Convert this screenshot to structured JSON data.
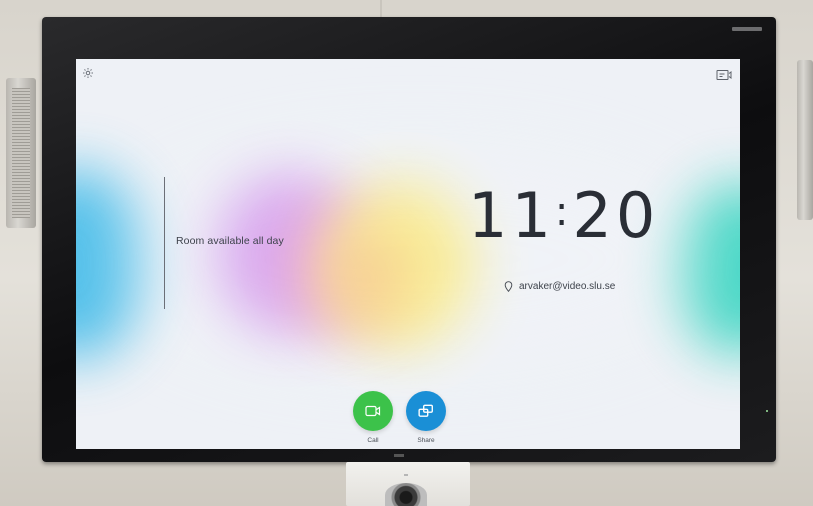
{
  "screen": {
    "availability_text": "Room available all day",
    "clock": {
      "hours": "11",
      "separator": ":",
      "minutes": "20"
    },
    "address": "arvaker@video.slu.se",
    "actions": [
      {
        "label": "Call",
        "icon": "video-camera-icon",
        "color": "#3cc24a"
      },
      {
        "label": "Share",
        "icon": "share-screen-icon",
        "color": "#1a8fd6"
      }
    ],
    "top_left_icon": "gear-icon",
    "top_right_icon": "selfview-icon"
  },
  "colors": {
    "call_button": "#3cc24a",
    "share_button": "#1a8fd6",
    "text_primary": "#2a2e36"
  }
}
